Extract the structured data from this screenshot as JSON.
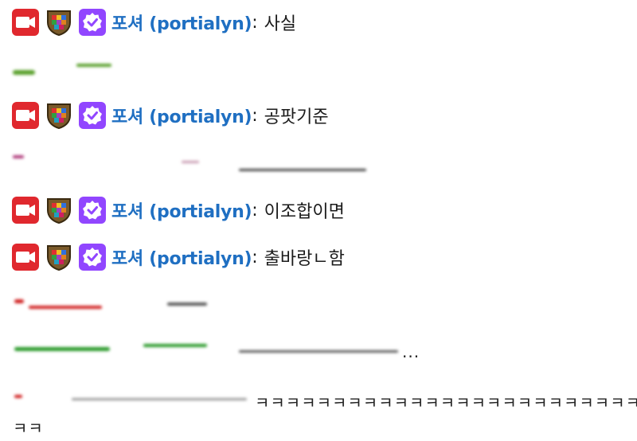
{
  "messages": [
    {
      "user": "포셔 (portialyn)",
      "separator": ":",
      "text": "사실"
    },
    {
      "user": "포셔 (portialyn)",
      "separator": ":",
      "text": "공팟기준"
    },
    {
      "user": "포셔 (portialyn)",
      "separator": ":",
      "text": "이조합이면"
    },
    {
      "user": "포셔 (portialyn)",
      "separator": ":",
      "text": "출바랑ㄴ함"
    }
  ],
  "fragments": {
    "ellipsis": "...",
    "laugh_line": "ㅋㅋㅋㅋㅋㅋㅋㅋㅋㅋㅋㅋㅋㅋㅋㅋㅋㅋㅋㅋㅋㅋㅋㅋㅋ",
    "laugh_wrap": "ㅋㅋ"
  },
  "colors": {
    "username": "#1f6fc2",
    "broadcaster_badge": "#e0282e",
    "verified_badge": "#9146ff"
  },
  "icons": [
    "camera-badge-icon",
    "crest-badge-icon",
    "verified-check-badge-icon"
  ]
}
